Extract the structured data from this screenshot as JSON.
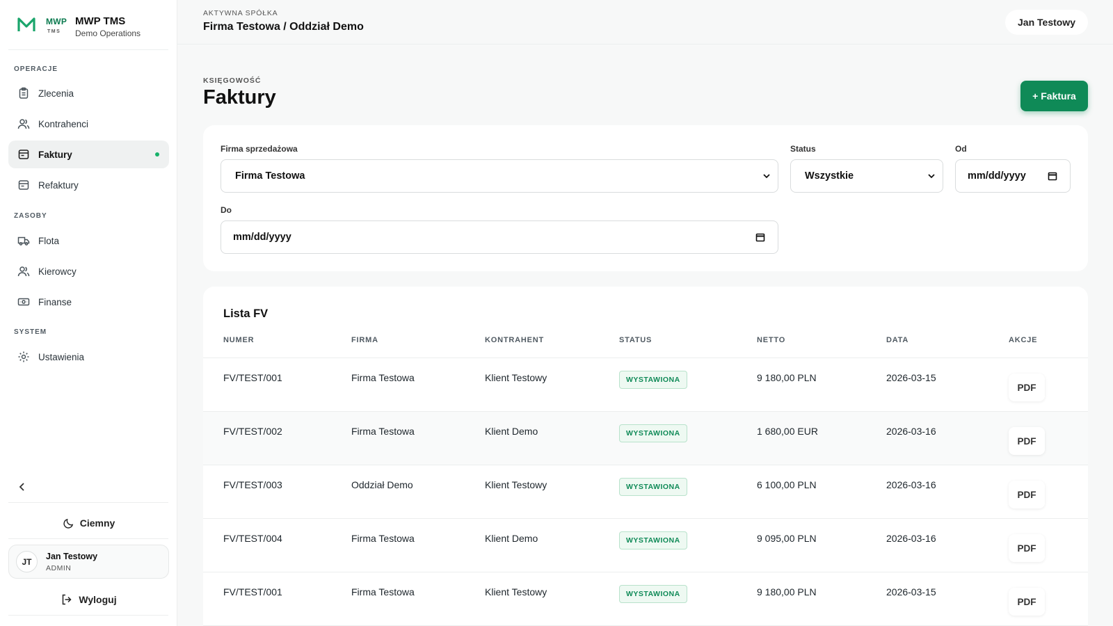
{
  "brand": {
    "logo_letter": "M",
    "mwp": "MWP",
    "tms": "TMS",
    "name": "MWP TMS",
    "subtitle": "Demo Operations"
  },
  "sidebar": {
    "sections": [
      {
        "label": "OPERACJE"
      },
      {
        "label": "ZASOBY"
      },
      {
        "label": "SYSTEM"
      }
    ],
    "items": [
      {
        "label": "Zlecenia",
        "icon": "clipboard-icon"
      },
      {
        "label": "Kontrahenci",
        "icon": "users-icon"
      },
      {
        "label": "Faktury",
        "icon": "invoice-icon",
        "active": true
      },
      {
        "label": "Refaktury",
        "icon": "invoice-icon"
      },
      {
        "label": "Flota",
        "icon": "truck-icon"
      },
      {
        "label": "Kierowcy",
        "icon": "users-icon"
      },
      {
        "label": "Finanse",
        "icon": "banknote-icon"
      },
      {
        "label": "Ustawienia",
        "icon": "gear-icon"
      }
    ],
    "theme_label": "Ciemny",
    "user": {
      "initials": "JT",
      "name": "Jan Testowy",
      "role": "ADMIN"
    },
    "logout_label": "Wyloguj"
  },
  "topbar": {
    "label": "AKTYWNA SPÓŁKA",
    "company": "Firma Testowa / Oddział Demo",
    "user": "Jan Testowy"
  },
  "page": {
    "eyebrow": "KSIĘGOWOŚĆ",
    "title": "Faktury",
    "add_button": "+ Faktura"
  },
  "filters": {
    "company_label": "Firma sprzedażowa",
    "company_value": "Firma Testowa",
    "status_label": "Status",
    "status_value": "Wszystkie",
    "from_label": "Od",
    "from_value": "mm/dd/yyyy",
    "to_label": "Do",
    "to_value": "mm/dd/yyyy"
  },
  "table": {
    "title": "Lista FV",
    "columns": [
      "NUMER",
      "FIRMA",
      "KONTRAHENT",
      "STATUS",
      "NETTO",
      "DATA",
      "AKCJE"
    ],
    "rows": [
      {
        "numer": "FV/TEST/001",
        "firma": "Firma Testowa",
        "kontrahent": "Klient Testowy",
        "status": "WYSTAWIONA",
        "netto": "9 180,00 PLN",
        "data": "2026-03-15",
        "akcja": "PDF"
      },
      {
        "numer": "FV/TEST/002",
        "firma": "Firma Testowa",
        "kontrahent": "Klient Demo",
        "status": "WYSTAWIONA",
        "netto": "1 680,00 EUR",
        "data": "2026-03-16",
        "akcja": "PDF"
      },
      {
        "numer": "FV/TEST/003",
        "firma": "Oddział Demo",
        "kontrahent": "Klient Testowy",
        "status": "WYSTAWIONA",
        "netto": "6 100,00 PLN",
        "data": "2026-03-16",
        "akcja": "PDF"
      },
      {
        "numer": "FV/TEST/004",
        "firma": "Firma Testowa",
        "kontrahent": "Klient Demo",
        "status": "WYSTAWIONA",
        "netto": "9 095,00 PLN",
        "data": "2026-03-16",
        "akcja": "PDF"
      },
      {
        "numer": "FV/TEST/001",
        "firma": "Firma Testowa",
        "kontrahent": "Klient Testowy",
        "status": "WYSTAWIONA",
        "netto": "9 180,00 PLN",
        "data": "2026-03-15",
        "akcja": "PDF"
      }
    ]
  },
  "colors": {
    "accent": "#0f8a57",
    "badge_bg": "#eef9f2",
    "active_dot": "#17b26a"
  }
}
